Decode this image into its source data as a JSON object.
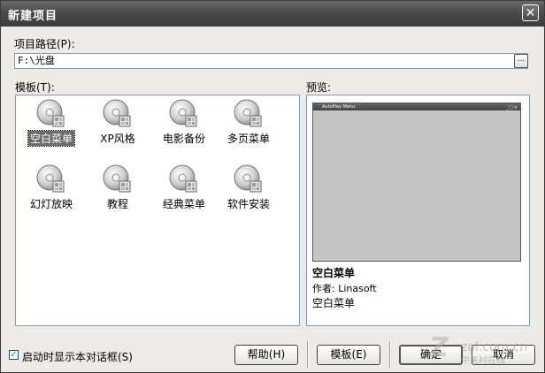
{
  "window": {
    "title": "新建项目",
    "close_glyph": "✕"
  },
  "path": {
    "label": "项目路径(P):",
    "value": "F:\\光盘",
    "browse_label": "..."
  },
  "templates": {
    "label": "模板(T):",
    "items": [
      {
        "name": "空白菜单",
        "selected": true
      },
      {
        "name": "XP风格",
        "selected": false
      },
      {
        "name": "电影备份",
        "selected": false
      },
      {
        "name": "多页菜单",
        "selected": false
      },
      {
        "name": "幻灯放映",
        "selected": false
      },
      {
        "name": "教程",
        "selected": false
      },
      {
        "name": "经典菜单",
        "selected": false
      },
      {
        "name": "软件安装",
        "selected": false
      }
    ],
    "icon": "cd-disc-icon"
  },
  "preview": {
    "label": "预览:",
    "mini_window_title": "AutoPlay Menu",
    "mini_window_buttons": "_□×",
    "name": "空白菜单",
    "author": "作者: Linasoft",
    "description": "空白菜单"
  },
  "footer": {
    "startup_checkbox_label": "启动时显示本对话框(S)",
    "startup_checked": true,
    "help_button": "帮助(H)",
    "template_button": "模板(E)",
    "ok_button": "确定",
    "cancel_button": "取消",
    "watermark": "ZOL.com.cn 中关村在线"
  }
}
